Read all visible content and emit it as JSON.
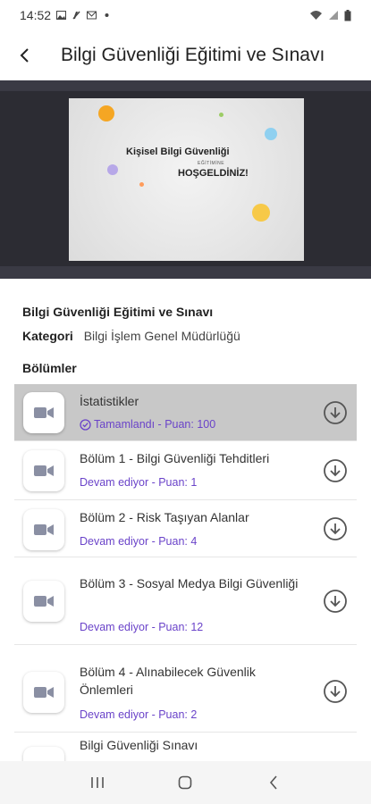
{
  "status_bar": {
    "time": "14:52",
    "left_icons": [
      "image-icon",
      "no-sound-icon",
      "mail-icon",
      "dot-icon"
    ],
    "right_icons": [
      "wifi-icon",
      "signal-icon",
      "battery-icon"
    ]
  },
  "app_bar": {
    "back_icon": "back-arrow-icon",
    "title": "Bilgi Güvenliği Eğitimi ve Sınavı"
  },
  "video": {
    "slide_line1": "Kişisel Bilgi Güvenliği",
    "slide_line2": "EĞİTİMİNE",
    "slide_line3": "HOŞGELDİNİZ!"
  },
  "course": {
    "title": "Bilgi Güvenliği Eğitimi ve Sınavı",
    "category_label": "Kategori",
    "category_value": "Bilgi İşlem Genel Müdürlüğü",
    "sections_title": "Bölümler"
  },
  "sections": [
    {
      "title": "İstatistikler",
      "status": "Tamamlandı - Puan: 100",
      "completed": true
    },
    {
      "title": "Bölüm 1 - Bilgi Güvenliği Tehditleri",
      "status": "Devam ediyor - Puan: 1"
    },
    {
      "title": "Bölüm 2 - Risk Taşıyan Alanlar",
      "status": "Devam ediyor - Puan: 4"
    },
    {
      "title": "Bölüm 3 - Sosyal Medya Bilgi Güvenliği",
      "status": "Devam ediyor - Puan: 12"
    },
    {
      "title": "Bölüm 4 - Alınabilecek Güvenlik Önlemleri",
      "status": "Devam ediyor - Puan: 2"
    },
    {
      "title": "Bilgi Güvenliği Sınavı",
      "status": ""
    }
  ],
  "colors": {
    "accent": "#6a43c9",
    "active_row": "#c8c8c8",
    "video_bg": "#2c2c33"
  },
  "nav_bar": {
    "icons": [
      "recent-apps-icon",
      "home-icon",
      "back-icon"
    ]
  }
}
